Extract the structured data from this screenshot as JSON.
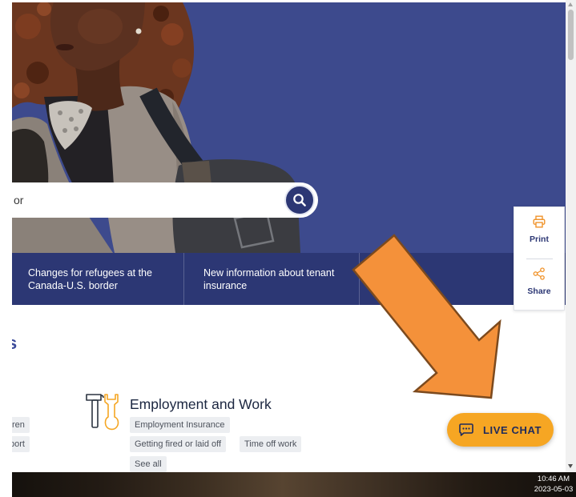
{
  "hero": {
    "search": {
      "placeholder": "or",
      "button_icon": "search-icon"
    }
  },
  "news": [
    {
      "text": "Changes for refugees at the Canada-U.S. border"
    },
    {
      "text": "New information about tenant insurance"
    }
  ],
  "side_tools": {
    "print_label": "Print",
    "print_icon": "printer-icon",
    "share_label": "Share",
    "share_icon": "share-icon"
  },
  "topics": {
    "heading_fragment": "s",
    "left_tags": [
      "ren",
      "port"
    ],
    "cards": [
      {
        "title": "Employment and Work",
        "icon": "tools-icon",
        "tags": [
          "Employment Insurance",
          "Getting fired or laid off",
          "Time off work",
          "See all"
        ]
      }
    ]
  },
  "live_chat": {
    "label": "LIVE CHAT",
    "icon": "chat-icon"
  },
  "taskbar": {
    "time": "10:46 AM",
    "date": "2023-05-03"
  },
  "colors": {
    "hero_background": "#3d4a8d",
    "news_bar": "#2c3774",
    "tool_icon_accent": "#f0932b",
    "live_chat_button": "#f6a623",
    "annotation_arrow": "#f4913a"
  }
}
